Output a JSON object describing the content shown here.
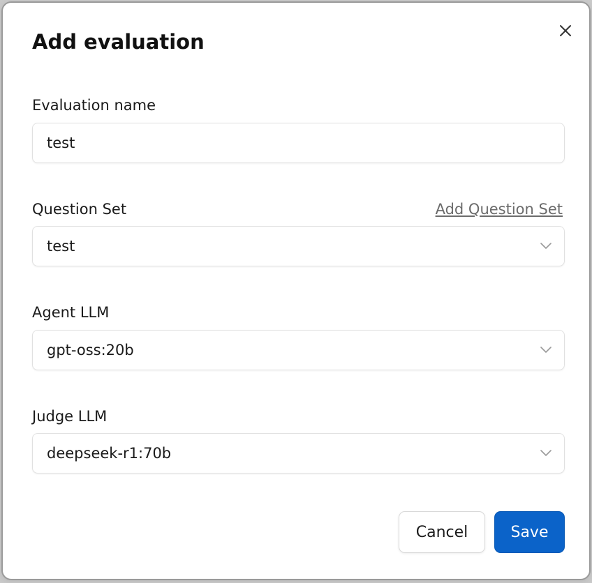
{
  "dialog": {
    "title": "Add evaluation",
    "close_icon": "close-icon"
  },
  "fields": {
    "evaluation_name": {
      "label": "Evaluation name",
      "value": "test"
    },
    "question_set": {
      "label": "Question Set",
      "link": "Add Question Set",
      "value": "test",
      "icon": "chevron-down-icon"
    },
    "agent_llm": {
      "label": "Agent LLM",
      "value": "gpt-oss:20b",
      "icon": "chevron-down-icon"
    },
    "judge_llm": {
      "label": "Judge LLM",
      "value": "deepseek-r1:70b",
      "icon": "chevron-down-icon"
    }
  },
  "actions": {
    "cancel_label": "Cancel",
    "save_label": "Save"
  },
  "colors": {
    "primary": "#0b63c9",
    "link": "#6b6b6b",
    "border": "#e1e1e1"
  }
}
